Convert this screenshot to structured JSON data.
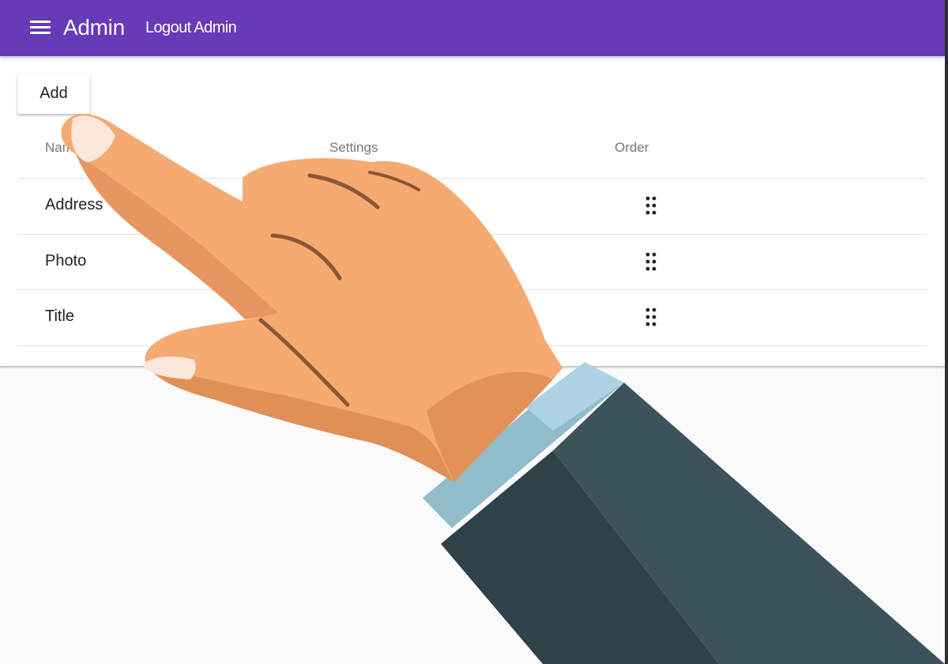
{
  "header": {
    "app_title": "Admin",
    "logout_label": "Logout Admin",
    "accent_color": "#673ab7"
  },
  "toolbar": {
    "add_label": "Add"
  },
  "table": {
    "columns": [
      "Name",
      "Settings",
      "Order"
    ],
    "rows": [
      {
        "name": "Address"
      },
      {
        "name": "Photo"
      },
      {
        "name": "Title"
      }
    ]
  },
  "icons": {
    "menu": "menu-icon",
    "drag": "drag-handle-icon"
  }
}
